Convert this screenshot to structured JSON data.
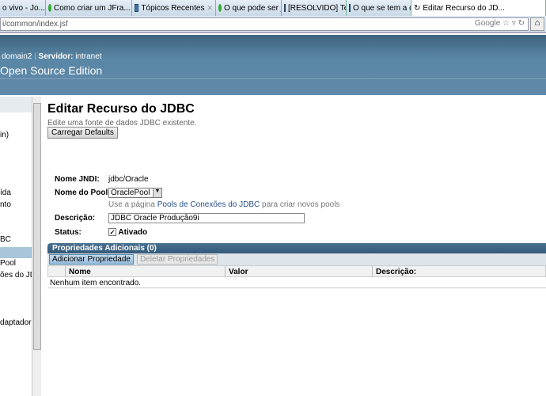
{
  "browser": {
    "tabs": [
      {
        "label": "o vivo - Jo...",
        "icon": "page-icon"
      },
      {
        "label": "Como criar um JFra...",
        "icon": "loading-icon"
      },
      {
        "label": "Tópicos Recentes",
        "icon": "page-icon"
      },
      {
        "label": "O que pode ser jpa.J...",
        "icon": "loading-icon"
      },
      {
        "label": "[RESOLVIDO] Temp...",
        "icon": "page-icon"
      },
      {
        "label": "O que se tem a dizer...",
        "icon": "page-icon"
      },
      {
        "label": "Editar Recurso do JD...",
        "icon": "loading-icon"
      }
    ],
    "url": "i/common/index.jsf",
    "search_engine": "Google"
  },
  "header": {
    "domain": "domain2",
    "server_label": "Servidor:",
    "server": "intranet",
    "title": "Open Source Edition"
  },
  "sidebar": {
    "items": [
      "in)",
      "ída",
      "nto",
      "BC",
      "",
      "Pool",
      "ões do JDBC",
      "daptador d"
    ]
  },
  "main": {
    "title": "Editar Recurso do JDBC",
    "subtitle": "Edite uma fonte de dados JDBC existente.",
    "load_defaults": "Carregar Defaults",
    "jndi_label": "Nome JNDI:",
    "jndi_value": "jdbc/Oracle",
    "pool_label": "Nome do Pool:",
    "pool_value": "OraclePool",
    "hint_pre": "Use a página ",
    "hint_link": "Pools de Conexões do JDBC",
    "hint_post": " para criar novos pools",
    "desc_label": "Descrição:",
    "desc_value": "JDBC Oracle Produção9i",
    "status_label": "Status:",
    "status_value": "Ativado",
    "status_checked": true
  },
  "properties": {
    "title": "Propriedades Adicionais (0)",
    "add": "Adicionar Propriedade",
    "delete": "Deletar Propriedades",
    "columns": [
      "Nome",
      "Valor",
      "Descrição:"
    ],
    "empty": "Nenhum item encontrado."
  }
}
